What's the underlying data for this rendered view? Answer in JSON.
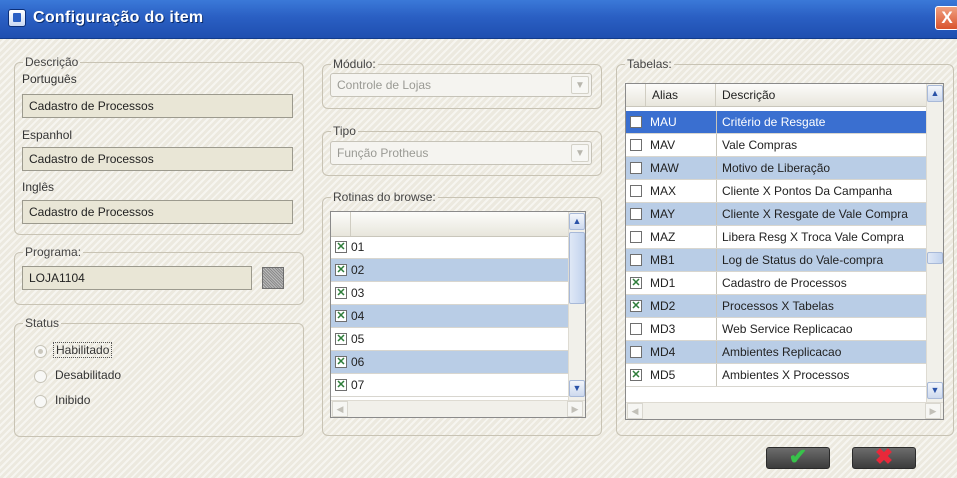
{
  "window": {
    "title": "Configuração do item",
    "close": "X"
  },
  "descricao": {
    "legend": "Descrição",
    "portugues_label": "Português",
    "portugues_value": "Cadastro de Processos",
    "espanhol_label": "Espanhol",
    "espanhol_value": "Cadastro de Processos",
    "ingles_label": "Inglês",
    "ingles_value": "Cadastro de Processos"
  },
  "programa": {
    "legend": "Programa:",
    "value": "LOJA1104"
  },
  "status": {
    "legend": "Status",
    "options": [
      "Habilitado",
      "Desabilitado",
      "Inibido"
    ],
    "selected": "Habilitado"
  },
  "modulo": {
    "legend": "Módulo:",
    "value": "Controle de Lojas"
  },
  "tipo": {
    "legend": "Tipo",
    "value": "Função Protheus"
  },
  "rotinas": {
    "legend": "Rotinas do browse:",
    "rows": [
      {
        "code": "01",
        "checked": true
      },
      {
        "code": "02",
        "checked": true
      },
      {
        "code": "03",
        "checked": true
      },
      {
        "code": "04",
        "checked": true
      },
      {
        "code": "05",
        "checked": true
      },
      {
        "code": "06",
        "checked": true
      },
      {
        "code": "07",
        "checked": true
      }
    ]
  },
  "tabelas": {
    "legend": "Tabelas:",
    "headers": {
      "alias": "Alias",
      "descricao": "Descrição"
    },
    "rows": [
      {
        "alias": "MAU",
        "descricao": "Critério de Resgate",
        "checked": false
      },
      {
        "alias": "MAV",
        "descricao": "Vale Compras",
        "checked": false
      },
      {
        "alias": "MAW",
        "descricao": "Motivo de Liberação",
        "checked": false
      },
      {
        "alias": "MAX",
        "descricao": "Cliente X Pontos Da Campanha",
        "checked": false
      },
      {
        "alias": "MAY",
        "descricao": "Cliente X Resgate de Vale Compra",
        "checked": false
      },
      {
        "alias": "MAZ",
        "descricao": "Libera Resg X Troca Vale Compra",
        "checked": false
      },
      {
        "alias": "MB1",
        "descricao": "Log de Status do Vale-compra",
        "checked": false
      },
      {
        "alias": "MD1",
        "descricao": "Cadastro de Processos",
        "checked": true
      },
      {
        "alias": "MD2",
        "descricao": "Processos X Tabelas",
        "checked": true
      },
      {
        "alias": "MD3",
        "descricao": "Web Service Replicacao",
        "checked": false
      },
      {
        "alias": "MD4",
        "descricao": "Ambientes Replicacao",
        "checked": false
      },
      {
        "alias": "MD5",
        "descricao": "Ambientes X Processos",
        "checked": true
      }
    ],
    "selected_index": 0
  },
  "buttons": {
    "confirm_glyph": "✔",
    "cancel_glyph": "✖"
  },
  "icons": {
    "window": "window-icon",
    "close": "close-icon",
    "lookup": "lookup-icon",
    "confirm": "checkmark-icon",
    "cancel": "x-icon"
  },
  "colors": {
    "titlebar": "#2a5fc3",
    "selected_row": "#3a6fd0",
    "alt_row": "#b9cde6",
    "confirm": "#37c24a",
    "cancel": "#e8283a"
  }
}
